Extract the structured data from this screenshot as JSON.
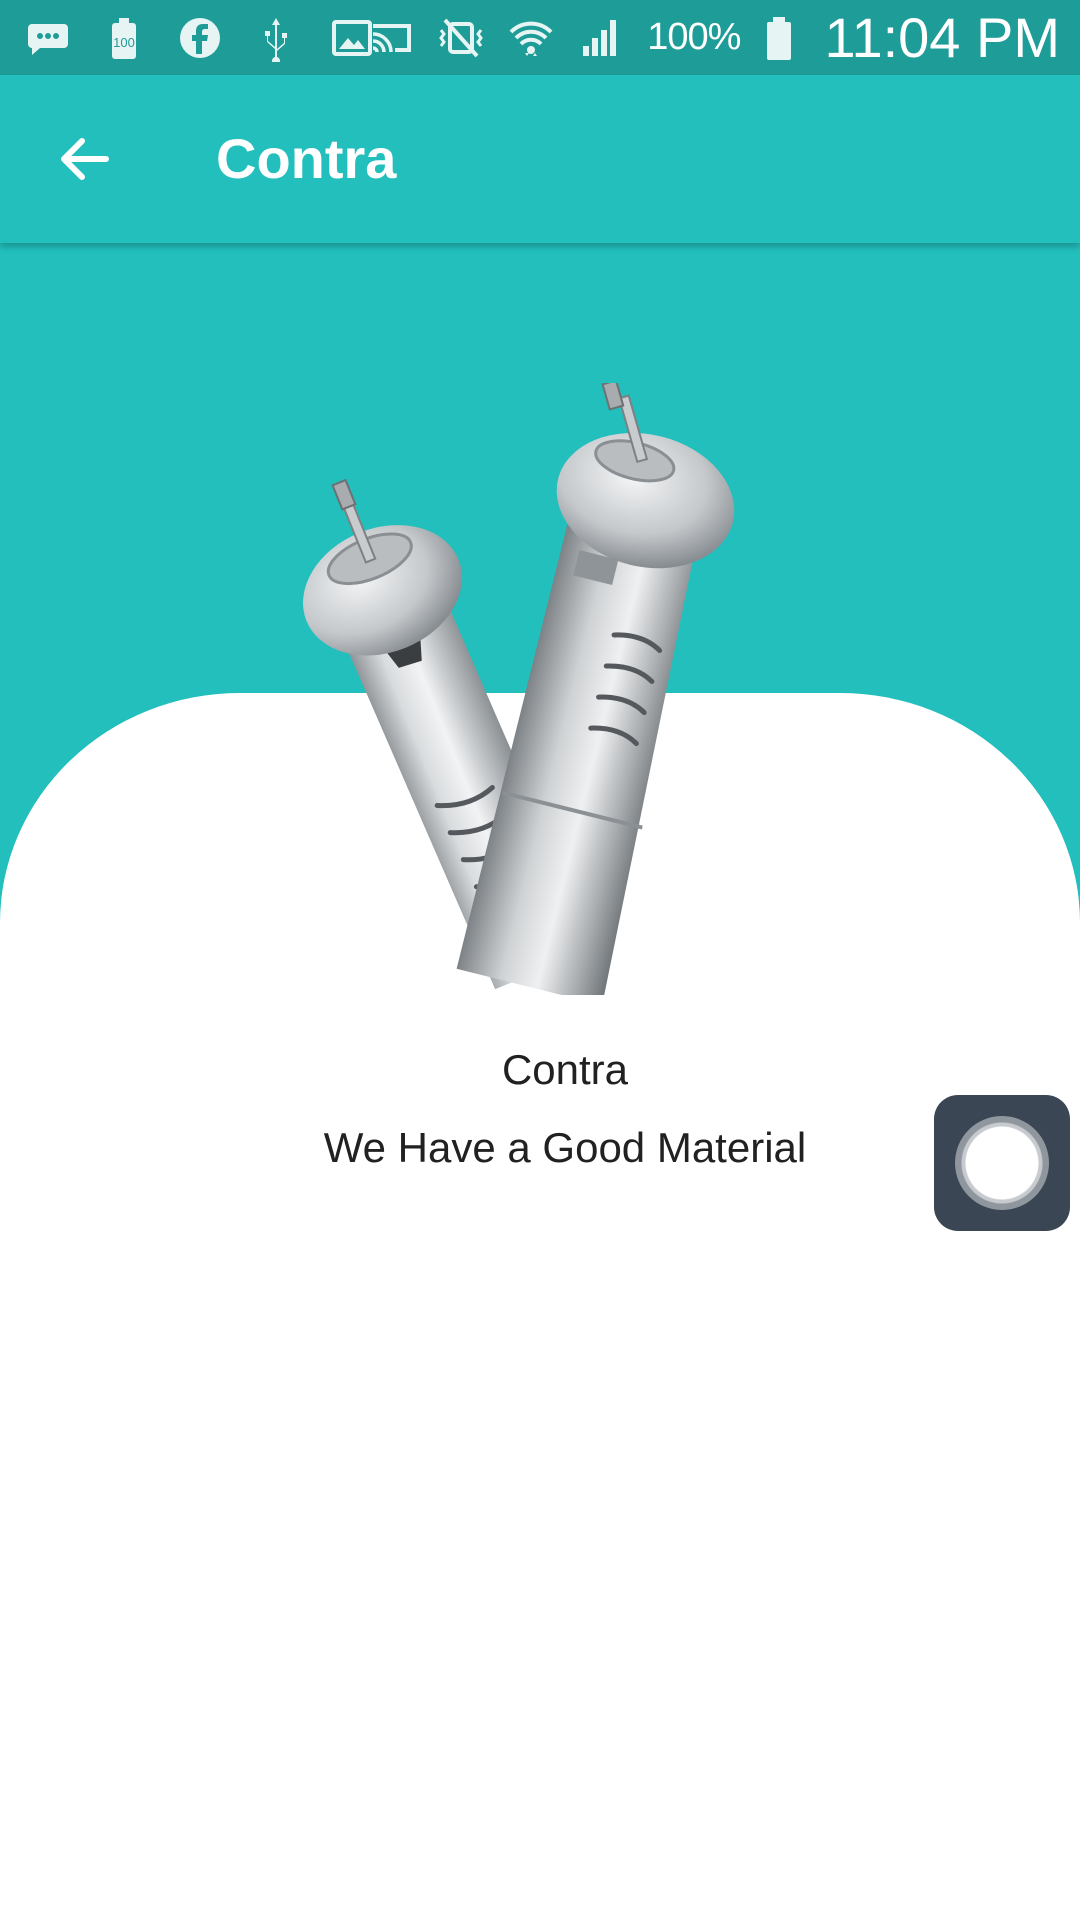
{
  "status_bar": {
    "icons_left": [
      "message-icon",
      "battery-saver-icon",
      "facebook-icon",
      "usb-icon",
      "image-icon"
    ],
    "icons_right": [
      "cast-icon",
      "vibrate-icon",
      "wifi-icon",
      "signal-icon",
      "battery-icon"
    ],
    "battery_saver_label": "100",
    "battery_percent": "100%",
    "time": "11:04 PM",
    "color": "#1e9c98"
  },
  "app_bar": {
    "back_icon": "arrow-back-icon",
    "title": "Contra",
    "color": "#22bfbd"
  },
  "hero": {
    "color": "#22bfbd",
    "image": "dental-handpieces"
  },
  "product": {
    "name": "Contra",
    "tagline": "We Have a Good Material"
  },
  "floating_button": {
    "icon": "assistive-touch-icon",
    "color": "#3a4653"
  }
}
